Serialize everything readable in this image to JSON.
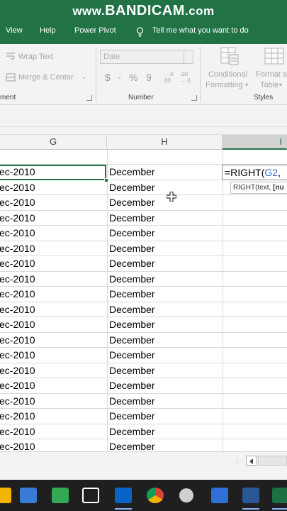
{
  "watermark": {
    "prefix": "www.",
    "brand": "BANDICAM",
    "suffix": ".com"
  },
  "menu": {
    "items": [
      {
        "label": "View"
      },
      {
        "label": "Help"
      },
      {
        "label": "Power Pivot"
      }
    ],
    "tell_me": "Tell me what you want to do"
  },
  "ribbon": {
    "wrap_text": "Wrap Text",
    "merge_center": "Merge & Center",
    "alignment_group_partial": "ment",
    "number_format_value": "Date",
    "currency_symbol": "$",
    "percent_symbol": "%",
    "comma_symbol": "9",
    "increase_decimal": "←.0 .00",
    "decrease_decimal": ".00 →.0",
    "number_group": "Number",
    "conditional_formatting_line1": "Conditional",
    "conditional_formatting_line2": "Formatting",
    "format_as_table_line1": "Format a",
    "format_as_table_line2": "Table",
    "styles_group": "Styles"
  },
  "columns": [
    {
      "label": "G"
    },
    {
      "label": "H"
    },
    {
      "label": "I"
    }
  ],
  "rows": [
    {
      "g": "ec-2010",
      "h": "December"
    },
    {
      "g": "ec-2010",
      "h": "December"
    },
    {
      "g": "ec-2010",
      "h": "December"
    },
    {
      "g": "ec-2010",
      "h": "December"
    },
    {
      "g": "ec-2010",
      "h": "December"
    },
    {
      "g": "ec-2010",
      "h": "December"
    },
    {
      "g": "ec-2010",
      "h": "December"
    },
    {
      "g": "ec-2010",
      "h": "December"
    },
    {
      "g": "ec-2010",
      "h": "December"
    },
    {
      "g": "ec-2010",
      "h": "December"
    },
    {
      "g": "ec-2010",
      "h": "December"
    },
    {
      "g": "ec-2010",
      "h": "December"
    },
    {
      "g": "ec-2010",
      "h": "December"
    },
    {
      "g": "ec-2010",
      "h": "December"
    },
    {
      "g": "ec-2010",
      "h": "December"
    },
    {
      "g": "ec-2010",
      "h": "December"
    },
    {
      "g": "ec-2010",
      "h": "December"
    },
    {
      "g": "ec-2010",
      "h": "December"
    },
    {
      "g": "ec-2010",
      "h": "December"
    }
  ],
  "active_cell": {
    "formula_prefix": "=RIGHT(",
    "formula_ref": "G2",
    "formula_suffix": ","
  },
  "tooltip": {
    "fn": "RIGHT(text, ",
    "optional": "[nu"
  },
  "taskbar": {
    "icons": [
      {
        "name": "file-explorer-icon",
        "color": "#f3b400"
      },
      {
        "name": "store-icon",
        "color": "#3a7bd5"
      },
      {
        "name": "meet-icon",
        "color": "#34a853"
      },
      {
        "name": "capcut-icon",
        "color": "#ffffff"
      },
      {
        "name": "outlook-icon",
        "color": "#0a64c8"
      },
      {
        "name": "chrome-icon",
        "color": "#db4437"
      },
      {
        "name": "settings-icon",
        "color": "#cfcfcf"
      },
      {
        "name": "snipping-tool-icon",
        "color": "#2f6fd6"
      },
      {
        "name": "word-icon",
        "color": "#2b5797"
      },
      {
        "name": "excel-icon",
        "color": "#1d7044"
      }
    ]
  }
}
